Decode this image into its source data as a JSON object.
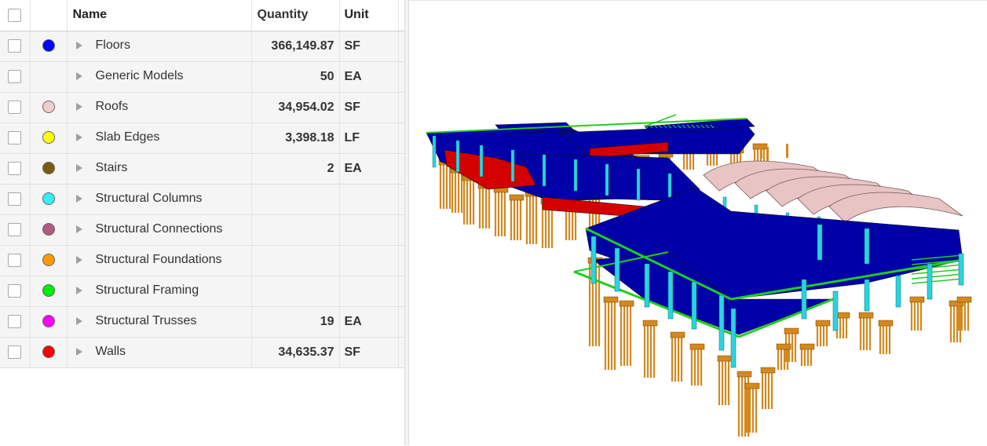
{
  "table": {
    "headers": {
      "name": "Name",
      "quantity": "Quantity",
      "unit": "Unit"
    },
    "rows": [
      {
        "name": "Floors",
        "quantity": "366,149.87",
        "unit": "SF",
        "color": "#0000ff"
      },
      {
        "name": "Generic Models",
        "quantity": "50",
        "unit": "EA",
        "color": ""
      },
      {
        "name": "Roofs",
        "quantity": "34,954.02",
        "unit": "SF",
        "color": "#f0cccc"
      },
      {
        "name": "Slab Edges",
        "quantity": "3,398.18",
        "unit": "LF",
        "color": "#ffff00"
      },
      {
        "name": "Stairs",
        "quantity": "2",
        "unit": "EA",
        "color": "#7a5a10"
      },
      {
        "name": "Structural Columns",
        "quantity": "",
        "unit": "",
        "color": "#33eeff"
      },
      {
        "name": "Structural Connections",
        "quantity": "",
        "unit": "",
        "color": "#b05a80"
      },
      {
        "name": "Structural Foundations",
        "quantity": "",
        "unit": "",
        "color": "#ff9900"
      },
      {
        "name": "Structural Framing",
        "quantity": "",
        "unit": "",
        "color": "#00ee00"
      },
      {
        "name": "Structural Trusses",
        "quantity": "19",
        "unit": "EA",
        "color": "#ff00ff"
      },
      {
        "name": "Walls",
        "quantity": "34,635.37",
        "unit": "SF",
        "color": "#ff0000"
      }
    ]
  },
  "viewer": {
    "palette": {
      "floor": "#0000a8",
      "column": "#2ad4e0",
      "foundation": "#d4881e",
      "framing": "#22cc22",
      "roof": "#e8c4c4",
      "wall": "#d40000"
    }
  }
}
